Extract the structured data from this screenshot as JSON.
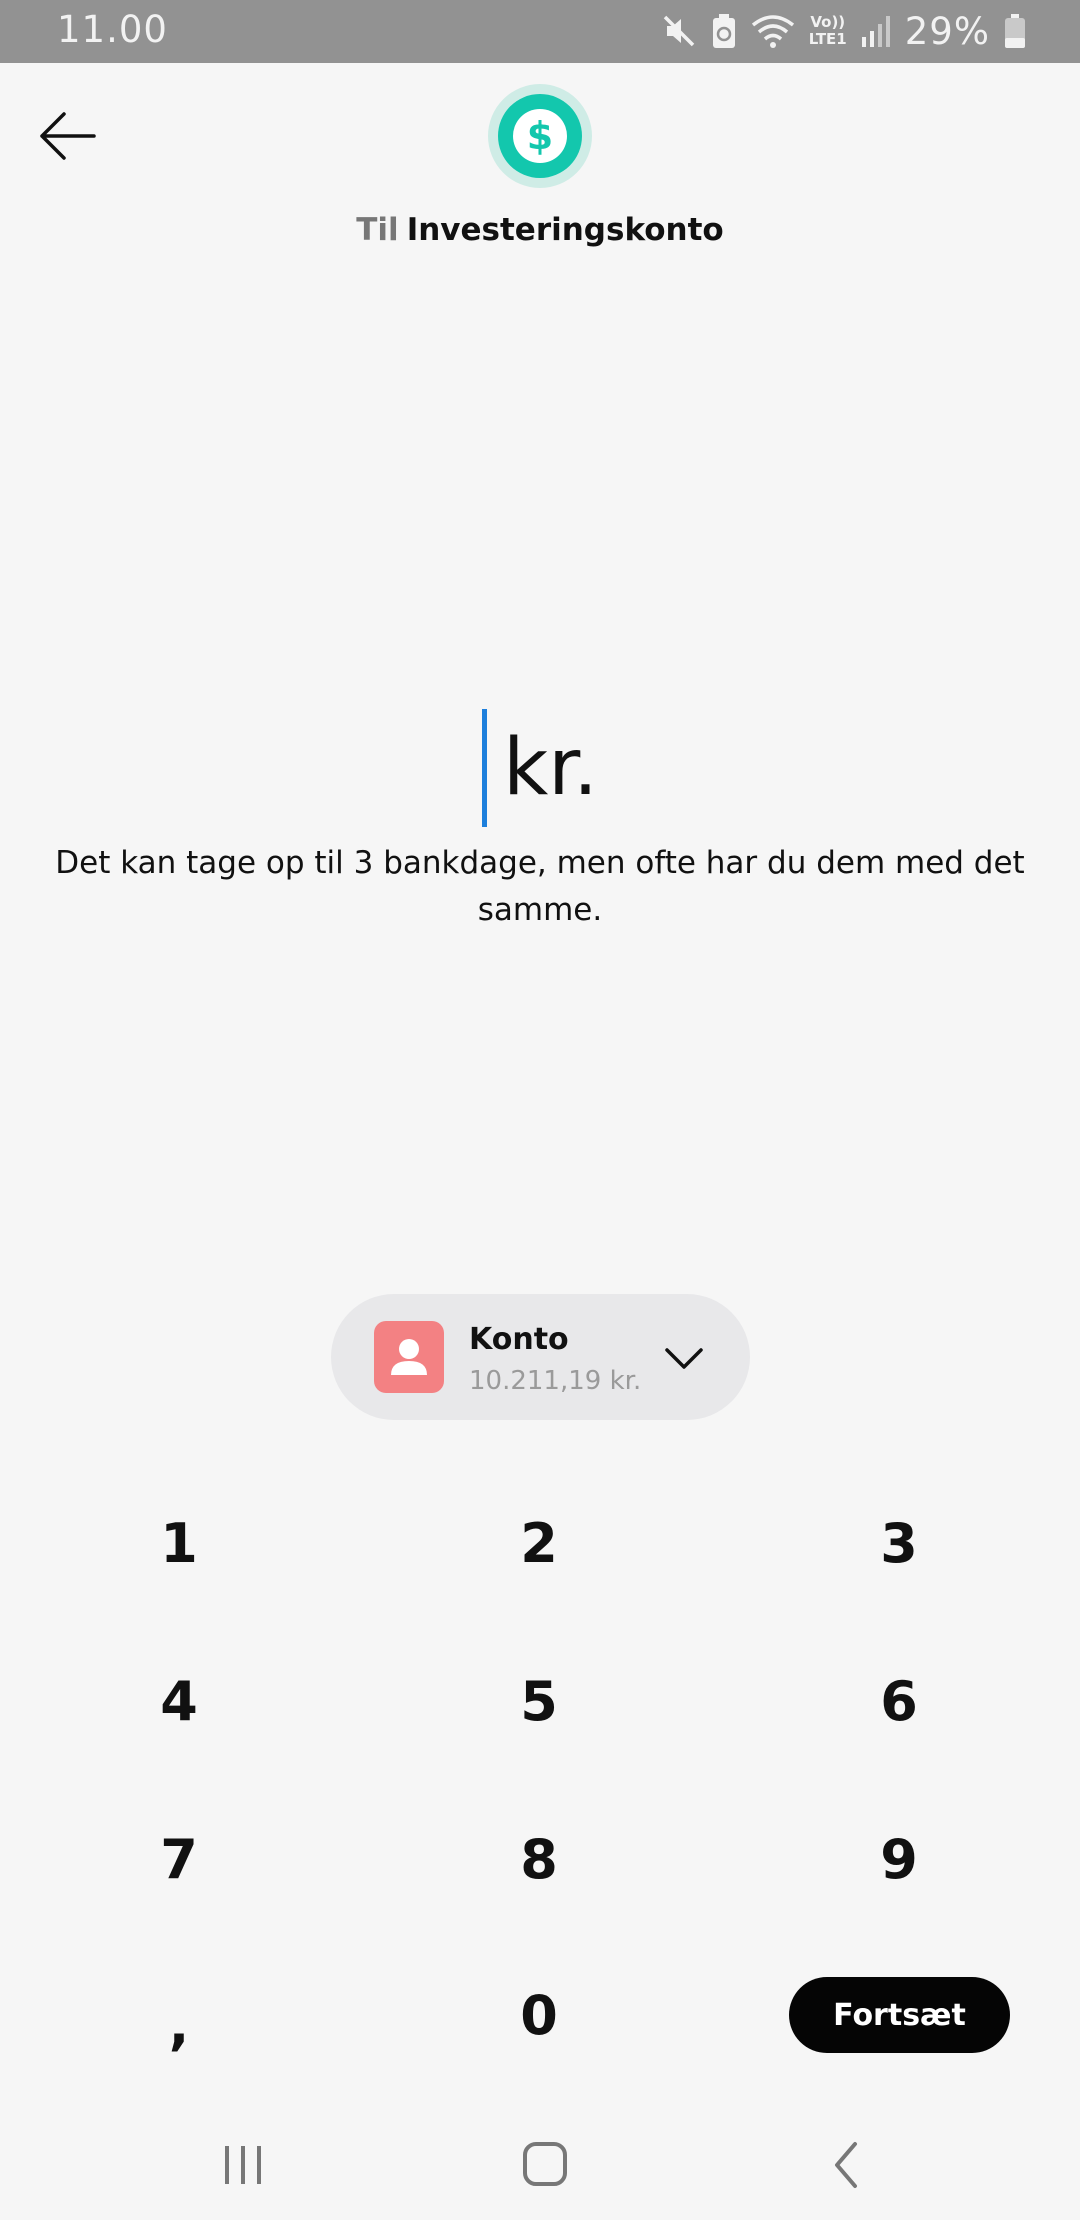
{
  "status_bar": {
    "time": "11.00",
    "battery_percent": "29%",
    "network_label_top": "Vo))",
    "network_label_bottom": "LTE1",
    "icons": [
      "mute-icon",
      "battery-saver-icon",
      "wifi-icon",
      "volte-icon",
      "signal-icon",
      "battery-icon"
    ]
  },
  "header": {
    "prefix": "Til",
    "account_name": "Investeringskonto",
    "icon": "dollar-icon",
    "accent_color": "#13c7ad"
  },
  "amount": {
    "value": "",
    "currency": "kr.",
    "cursor_color": "#1d7fdc"
  },
  "info_text": "Det kan tage op til 3 bankdage, men ofte har du dem med det samme.",
  "source_account": {
    "name": "Konto",
    "balance": "10.211,19 kr.",
    "avatar_color": "#f38183",
    "icon": "person-icon"
  },
  "keypad": {
    "keys": [
      "1",
      "2",
      "3",
      "4",
      "5",
      "6",
      "7",
      "8",
      "9",
      ",",
      "0"
    ],
    "continue_label": "Fortsæt"
  },
  "nav_bar": {
    "buttons": [
      "recents-icon",
      "home-icon",
      "back-icon"
    ]
  }
}
